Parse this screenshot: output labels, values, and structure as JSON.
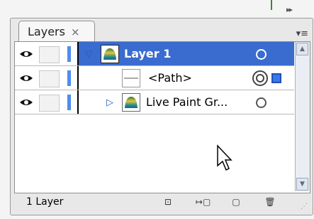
{
  "panel": {
    "tab": {
      "label": "Layers",
      "close": "×"
    },
    "top_arrows": "▸▸",
    "menu_icon": "▾≡"
  },
  "rows": [
    {
      "label": "Layer 1",
      "selected": true,
      "expanded": true
    },
    {
      "label": "<Path>",
      "selected": false
    },
    {
      "label": "Live Paint Gr...",
      "selected": false,
      "expanded": false
    }
  ],
  "status": {
    "count_text": "1 Layer"
  },
  "icons": {
    "visibility": "eye-icon",
    "target": "target-circle-icon",
    "trash": "trash-icon"
  },
  "colors": {
    "selection": "#3a6bcf",
    "layer_color": "#4f8cf0"
  }
}
